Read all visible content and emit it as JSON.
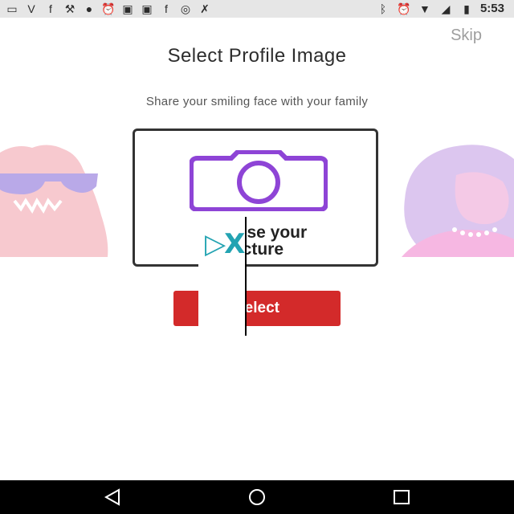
{
  "status_bar": {
    "time": "5:53",
    "left_icons": [
      "message-icon",
      "v-icon",
      "facebook-icon",
      "wrench-icon",
      "location-icon",
      "alarm-icon",
      "image-icon",
      "image-icon",
      "facebook-icon",
      "circle-icon",
      "tool-icon"
    ],
    "right_icons": [
      "bluetooth-icon",
      "alarm-icon",
      "wifi-icon",
      "signal-icon",
      "battery-icon"
    ]
  },
  "header": {
    "skip_label": "Skip",
    "title": "Select Profile Image",
    "subtitle": "Share your smiling face with your family"
  },
  "picker": {
    "label_line1": "Choose your",
    "label_line2": "picture",
    "icon": "camera-icon",
    "icon_color": "#8e44d6"
  },
  "button": {
    "select_label": "Select",
    "color": "#d32a2a"
  },
  "overlay": {
    "glyph_text": "▷X"
  },
  "nav_bar": {
    "icons": [
      "back-icon",
      "home-icon",
      "recents-icon"
    ]
  }
}
